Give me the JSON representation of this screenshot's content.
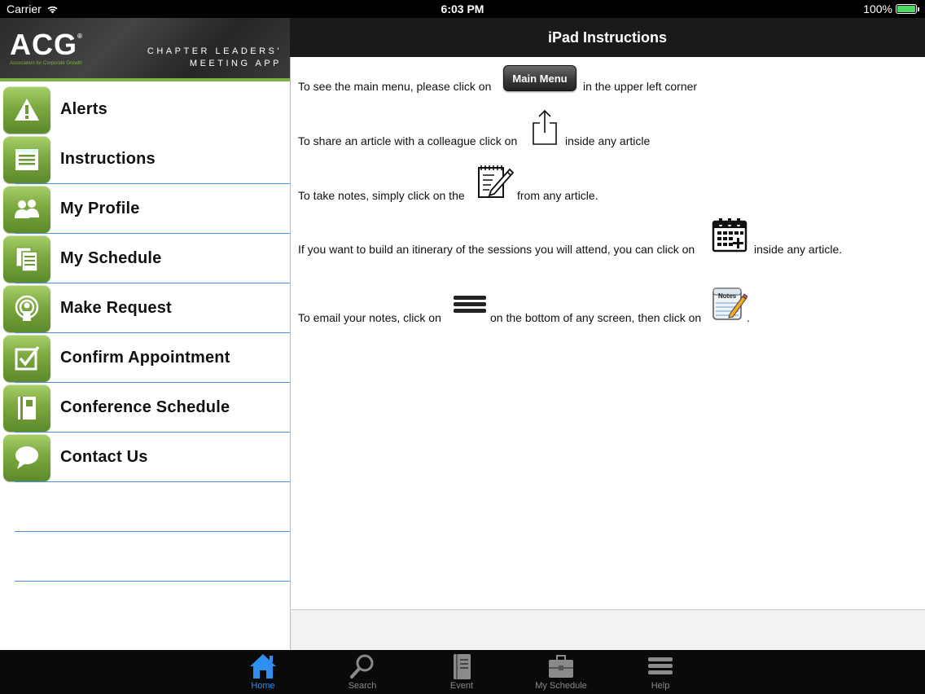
{
  "status_bar": {
    "carrier": "Carrier",
    "time": "6:03 PM",
    "battery": "100%"
  },
  "brand": {
    "logo": "ACG",
    "tagline": "Association for Corporate Growth",
    "title_line1": "CHAPTER LEADERS'",
    "title_line2": "MEETING APP",
    "accent_color": "#7cb342"
  },
  "menu": {
    "items": [
      {
        "label": "Alerts",
        "icon": "alert-icon"
      },
      {
        "label": "Instructions",
        "icon": "instructions-icon"
      },
      {
        "label": "My Profile",
        "icon": "profile-icon"
      },
      {
        "label": "My Schedule",
        "icon": "schedule-icon"
      },
      {
        "label": "Make Request",
        "icon": "request-icon"
      },
      {
        "label": "Confirm Appointment",
        "icon": "checkbox-icon"
      },
      {
        "label": "Conference Schedule",
        "icon": "notebook-icon"
      },
      {
        "label": "Contact Us",
        "icon": "speech-bubble-icon"
      }
    ]
  },
  "nav": {
    "title": "iPad Instructions"
  },
  "instructions": {
    "main_menu_before": "To see the main menu, please click on",
    "main_menu_button": "Main Menu",
    "main_menu_after": "in the upper left corner",
    "share_before": "To share an article with a colleague click on",
    "share_after": "inside any article",
    "notes_before": "To take notes, simply click on the",
    "notes_after": "from any article.",
    "itinerary_before": "If you want to build an itinerary of the sessions you will attend, you can click on",
    "itinerary_after": "inside any article.",
    "email_before": "To email your notes,  click on",
    "email_middle": "on the bottom of any screen, then click on",
    "email_after": ".",
    "notes_icon_text": "Notes"
  },
  "tabs": [
    {
      "label": "Home",
      "icon": "home-icon",
      "active": true
    },
    {
      "label": "Search",
      "icon": "search-icon",
      "active": false
    },
    {
      "label": "Event",
      "icon": "event-notebook-icon",
      "active": false
    },
    {
      "label": "My Schedule",
      "icon": "briefcase-icon",
      "active": false
    },
    {
      "label": "Help",
      "icon": "hamburger-icon",
      "active": false
    }
  ],
  "colors": {
    "active_tab": "#2f8ff0",
    "divider": "#4a90d9"
  }
}
